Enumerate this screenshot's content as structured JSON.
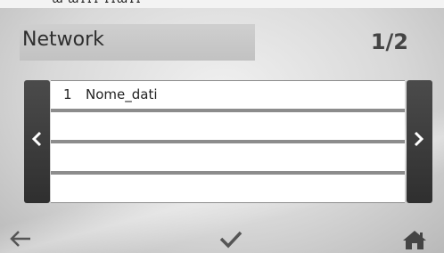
{
  "header": {
    "title": "Network",
    "page_indicator": "1/2"
  },
  "list": {
    "rows": [
      {
        "index": "1",
        "name": "Nome_dati"
      },
      {
        "index": "",
        "name": ""
      },
      {
        "index": "",
        "name": ""
      },
      {
        "index": "",
        "name": ""
      }
    ]
  },
  "navigation": {
    "prev_icon": "chevron-left-icon",
    "next_icon": "chevron-right-icon"
  },
  "footer": {
    "back_icon": "arrow-left-icon",
    "confirm_icon": "check-icon",
    "home_icon": "home-icon"
  },
  "colors": {
    "screen_background": "#d9d9d9",
    "title_bar": "#c8c8c8",
    "nav_buttons": "#3c3c3c",
    "row_background": "#ffffff",
    "row_separator": "#8c8c8c",
    "icons": "#505050"
  }
}
